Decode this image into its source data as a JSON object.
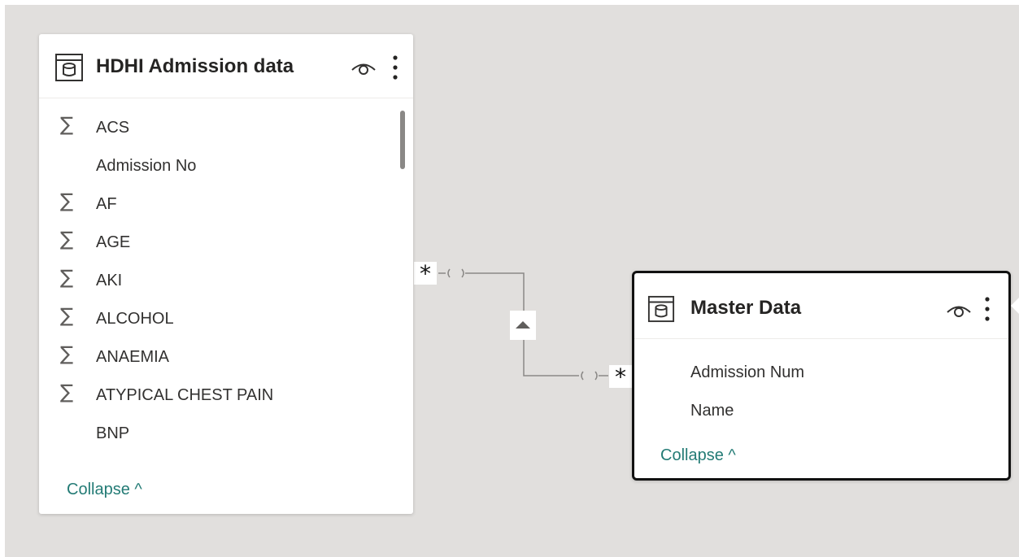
{
  "tables": [
    {
      "title": "HDHI Admission data",
      "fields": [
        {
          "name": "ACS",
          "icon": "sigma-icon"
        },
        {
          "name": "Admission No",
          "icon": ""
        },
        {
          "name": "AF",
          "icon": "sigma-icon"
        },
        {
          "name": "AGE",
          "icon": "sigma-icon"
        },
        {
          "name": "AKI",
          "icon": "sigma-icon"
        },
        {
          "name": "ALCOHOL",
          "icon": "sigma-icon"
        },
        {
          "name": "ANAEMIA",
          "icon": "sigma-icon"
        },
        {
          "name": "ATYPICAL CHEST PAIN",
          "icon": "sigma-icon"
        },
        {
          "name": "BNP",
          "icon": ""
        }
      ],
      "collapse_label": "Collapse ^"
    },
    {
      "title": "Master Data",
      "fields": [
        {
          "name": "Admission Num",
          "icon": ""
        },
        {
          "name": "Name",
          "icon": ""
        }
      ],
      "collapse_label": "Collapse ^"
    }
  ],
  "relationship": {
    "left_cardinality": "*",
    "right_cardinality": "*",
    "filter_direction_icon": "triangle-up-icon"
  },
  "colors": {
    "canvas": "#e1dfdd",
    "card": "#ffffff",
    "link": "#237b75",
    "selected_border": "#111111"
  }
}
